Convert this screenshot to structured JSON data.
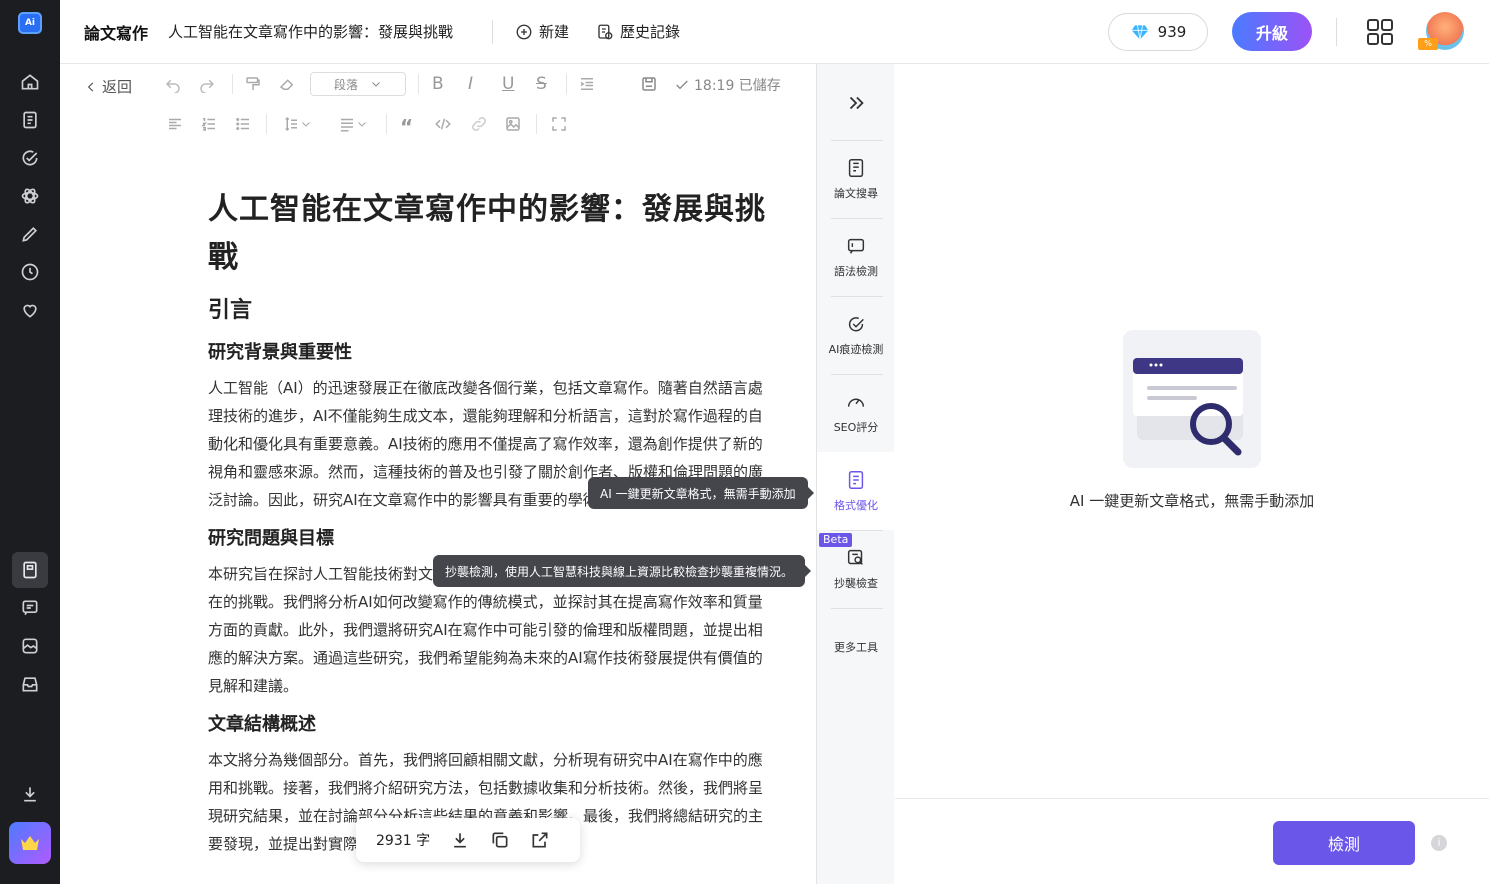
{
  "sidebar": {
    "logo": "Ai",
    "icons": [
      "home-icon",
      "document-icon",
      "check-circle-icon",
      "atom-icon",
      "pencil-icon",
      "history-icon",
      "heart-icon",
      "notebook-icon",
      "chat-icon",
      "image-icon",
      "inbox-icon",
      "download-icon",
      "crown-icon"
    ]
  },
  "header": {
    "app_title": "論文寫作",
    "doc_title": "人工智能在文章寫作中的影響：發展與挑戰",
    "new_label": "新建",
    "history_label": "歷史記錄",
    "credits": "939",
    "upgrade_label": "升級",
    "avatar_badge": "%"
  },
  "toolbar": {
    "back_label": "返回",
    "paragraph_select": "段落",
    "saved_status": "18:19 已儲存"
  },
  "document": {
    "title": "人工智能在文章寫作中的影響：發展與挑戰",
    "section1": "引言",
    "sub1": "研究背景與重要性",
    "p1": "人工智能（AI）的迅速發展正在徹底改變各個行業，包括文章寫作。隨著自然語言處理技術的進步，AI不僅能夠生成文本，還能夠理解和分析語言，這對於寫作過程的自動化和優化具有重要意義。AI技術的應用不僅提高了寫作效率，還為創作提供了新的視角和靈感來源。然而，這種技術的普及也引發了關於創作者、版權和倫理問題的廣泛討論。因此，研究AI在文章寫作中的影響具有重要的學術和實踐意義。",
    "sub2": "研究問題與目標",
    "p2": "本研究旨在探討人工智能技術對文章寫作的影響，特別是其在創作過程中的角色和潛在的挑戰。我們將分析AI如何改變寫作的傳統模式，並探討其在提高寫作效率和質量方面的貢獻。此外，我們還將研究AI在寫作中可能引發的倫理和版權問題，並提出相應的解決方案。通過這些研究，我們希望能夠為未來的AI寫作技術發展提供有價值的見解和建議。",
    "sub3": "文章結構概述",
    "p3": "本文將分為幾個部分。首先，我們將回顧相關文獻，分析現有研究中AI在寫作中的應用和挑戰。接著，我們將介紹研究方法，包括數據收集和分析技術。然後，我們將呈現研究結果，並在討論部分分析這些結果的意義和影響。最後，我們將總結研究的主要發現，並提出對實際應用和未來研究的建議。"
  },
  "tooltips": {
    "format": "AI 一鍵更新文章格式，無需手動添加",
    "plagiarism": "抄襲檢測，使用人工智慧科技與線上資源比較檢查抄襲重複情況。"
  },
  "bottom_bar": {
    "word_count": "2931 字"
  },
  "tools": {
    "items": [
      {
        "label": "論文搜尋",
        "icon": "paper-search-icon"
      },
      {
        "label": "語法檢測",
        "icon": "grammar-check-icon"
      },
      {
        "label": "AI痕迹檢測",
        "icon": "ai-detect-icon"
      },
      {
        "label": "SEO評分",
        "icon": "gauge-icon"
      },
      {
        "label": "格式優化",
        "icon": "format-icon"
      },
      {
        "label": "抄襲檢查",
        "icon": "plagiarism-icon"
      }
    ],
    "beta_label": "Beta",
    "more_label": "更多工具"
  },
  "panel": {
    "description": "AI 一鍵更新文章格式，無需手動添加",
    "detect_label": "檢測",
    "info_icon": "i"
  },
  "colors": {
    "accent": "#6a56e8",
    "sidebar_bg": "#1c1d21",
    "upgrade_from": "#4a7bff",
    "upgrade_to": "#9c52f5"
  }
}
